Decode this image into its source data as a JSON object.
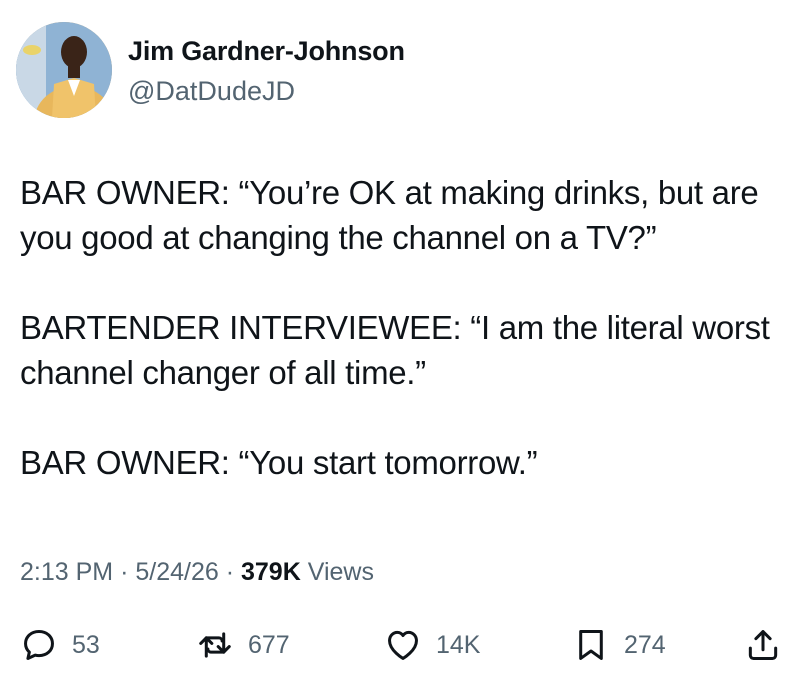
{
  "author": {
    "name": "Jim Gardner-Johnson",
    "handle": "@DatDudeJD"
  },
  "tweet": {
    "paragraphs": [
      "BAR OWNER: “You’re OK at making drinks, but are you good at changing the channel on a TV?”",
      "BARTENDER INTERVIEWEE: “I am the literal worst channel changer of all time.”",
      "BAR OWNER: “You start tomorrow.”"
    ]
  },
  "meta": {
    "time": "2:13 PM",
    "separator": "·",
    "date": "5/24/26",
    "views_count": "379K",
    "views_label": "Views"
  },
  "actions": {
    "replies": "53",
    "reposts": "677",
    "likes": "14K",
    "bookmarks": "274"
  },
  "icons": {
    "reply": "reply-icon",
    "repost": "repost-icon",
    "like": "heart-icon",
    "bookmark": "bookmark-icon",
    "share": "share-icon"
  },
  "colors": {
    "text": "#0f1419",
    "secondary": "#536471"
  }
}
